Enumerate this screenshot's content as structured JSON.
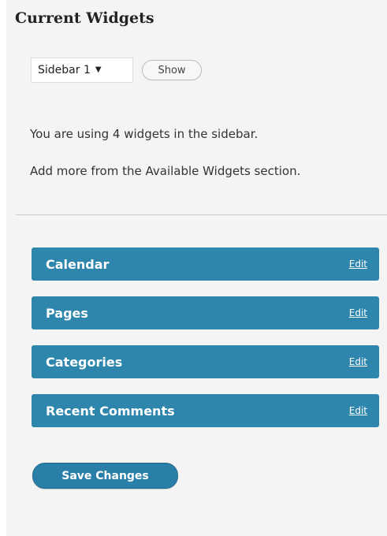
{
  "header": {
    "title": "Current Widgets"
  },
  "sidebar_select": {
    "selected": "Sidebar 1",
    "caret_icon": "caret-down-icon"
  },
  "show_button": {
    "label": "Show"
  },
  "info": {
    "widget_count_text": "You are using 4 widgets in the sidebar.",
    "add_more_text": "Add more from the Available Widgets section."
  },
  "widgets": [
    {
      "name": "Calendar",
      "edit_label": "Edit"
    },
    {
      "name": "Pages",
      "edit_label": "Edit"
    },
    {
      "name": "Categories",
      "edit_label": "Edit"
    },
    {
      "name": "Recent Comments",
      "edit_label": "Edit"
    }
  ],
  "save_button": {
    "label": "Save Changes"
  },
  "colors": {
    "widget_bar": "#2e86ac",
    "panel_background": "#f4f4f4",
    "save_button": "#2a7fa8"
  }
}
